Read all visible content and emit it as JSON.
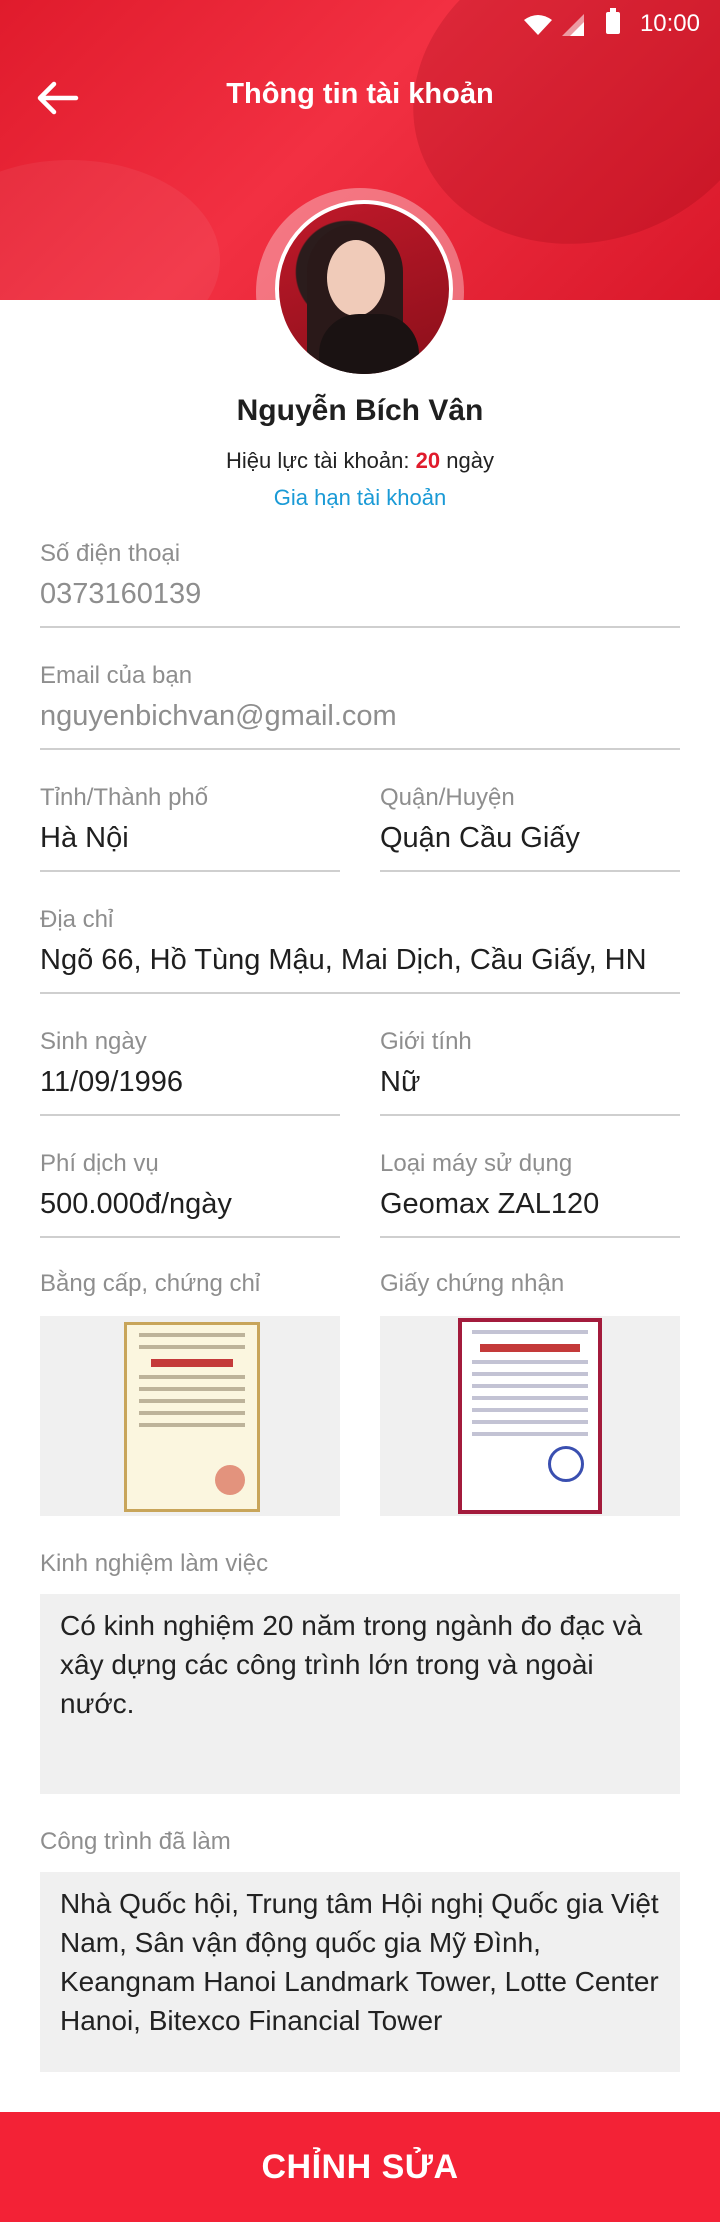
{
  "status_bar": {
    "time": "10:00"
  },
  "header": {
    "title": "Thông tin tài khoản"
  },
  "profile": {
    "name": "Nguyễn Bích Vân",
    "validity_label": "Hiệu lực tài khoản:",
    "validity_days": "20",
    "validity_unit": "ngày",
    "renew_link": "Gia hạn tài khoản"
  },
  "fields": {
    "phone": {
      "label": "Số điện thoại",
      "value": "0373160139"
    },
    "email": {
      "label": "Email của bạn",
      "value": "nguyenbichvan@gmail.com"
    },
    "province": {
      "label": "Tỉnh/Thành phố",
      "value": "Hà Nội"
    },
    "district": {
      "label": "Quận/Huyện",
      "value": "Quận Cầu Giấy"
    },
    "address": {
      "label": "Địa chỉ",
      "value": "Ngõ 66, Hồ Tùng Mậu, Mai Dịch, Cầu Giấy, HN"
    },
    "birthday": {
      "label": "Sinh ngày",
      "value": "11/09/1996"
    },
    "gender": {
      "label": "Giới tính",
      "value": "Nữ"
    },
    "service_fee": {
      "label": "Phí dịch vụ",
      "value": "500.000đ/ngày"
    },
    "device": {
      "label": "Loại máy sử dụng",
      "value": "Geomax ZAL120"
    },
    "degrees": {
      "label": "Bằng cấp, chứng chỉ"
    },
    "certificate": {
      "label": "Giấy chứng nhận"
    },
    "experience": {
      "label": "Kinh nghiệm làm việc",
      "value": "Có kinh nghiệm 20 năm trong ngành đo đạc và xây dựng các công trình lớn trong và ngoài nước."
    },
    "projects": {
      "label": "Công trình đã làm",
      "value": "Nhà Quốc hội, Trung tâm Hội nghị Quốc gia Việt Nam, Sân vận động quốc gia Mỹ Đình, Keangnam Hanoi Landmark Tower, Lotte Center Hanoi, Bitexco Financial Tower"
    }
  },
  "actions": {
    "edit": "CHỈNH SỬA"
  },
  "colors": {
    "brand_red": "#f32236",
    "link_blue": "#1a9ad6",
    "label_gray": "#8e8e8e"
  }
}
